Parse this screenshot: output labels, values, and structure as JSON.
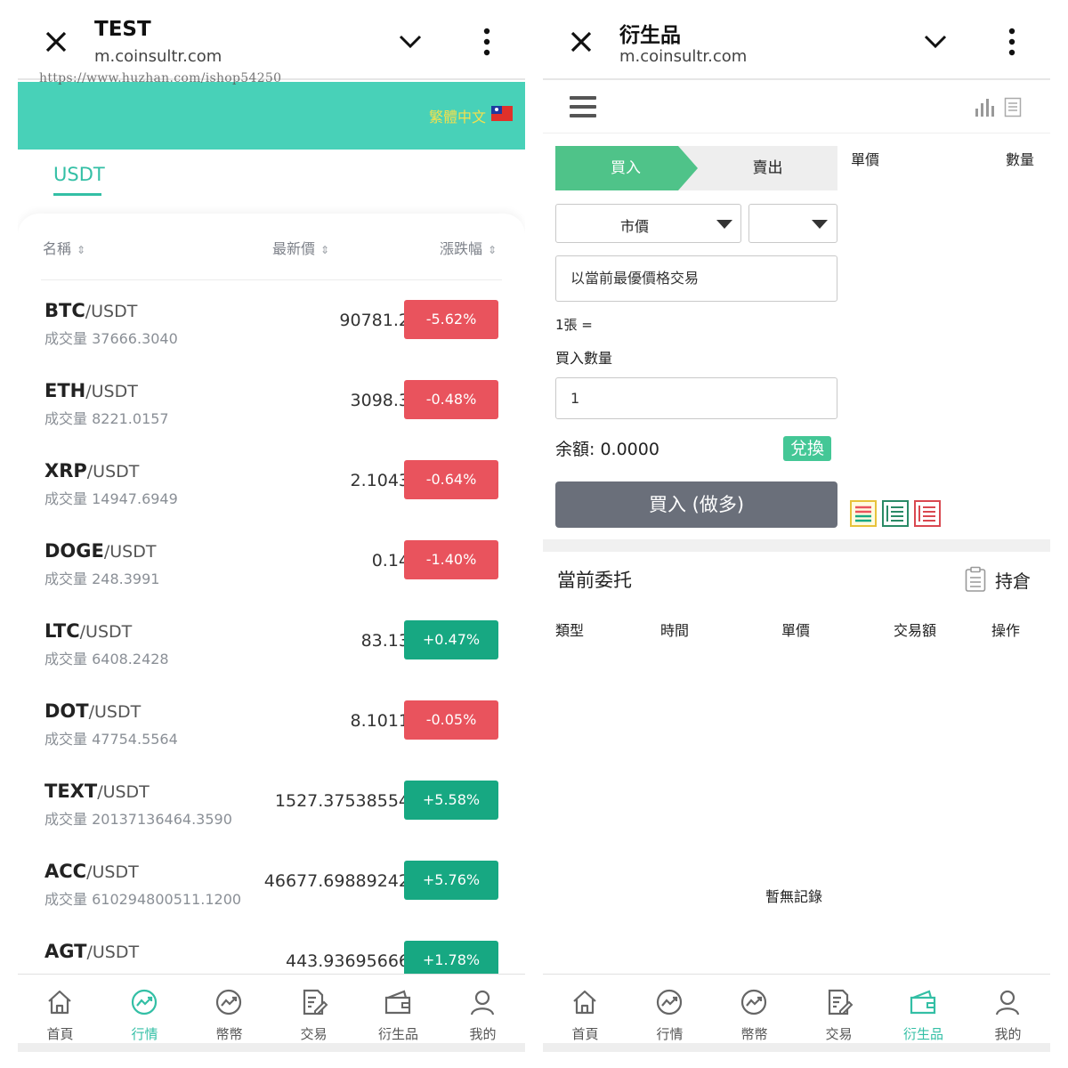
{
  "left": {
    "browser": {
      "title": "TEST",
      "url": "m.coinsultr.com"
    },
    "watermark": "https://www.huzhan.com/ishop54250",
    "language": "繁體中文",
    "tab": "USDT",
    "columns": {
      "name": "名稱",
      "price": "最新價",
      "change": "漲跌幅"
    },
    "markets": [
      {
        "base": "BTC",
        "quote": "/USDT",
        "volume": "成交量 37666.3040",
        "price": "90781.2",
        "change": "-5.62%",
        "dir": "down"
      },
      {
        "base": "ETH",
        "quote": "/USDT",
        "volume": "成交量 8221.0157",
        "price": "3098.3",
        "change": "-0.48%",
        "dir": "down"
      },
      {
        "base": "XRP",
        "quote": "/USDT",
        "volume": "成交量 14947.6949",
        "price": "2.1043",
        "change": "-0.64%",
        "dir": "down"
      },
      {
        "base": "DOGE",
        "quote": "/USDT",
        "volume": "成交量 248.3991",
        "price": "0.14",
        "change": "-1.40%",
        "dir": "down"
      },
      {
        "base": "LTC",
        "quote": "/USDT",
        "volume": "成交量 6408.2428",
        "price": "83.13",
        "change": "+0.47%",
        "dir": "up"
      },
      {
        "base": "DOT",
        "quote": "/USDT",
        "volume": "成交量 47754.5564",
        "price": "8.1011",
        "change": "-0.05%",
        "dir": "down"
      },
      {
        "base": "TEXT",
        "quote": "/USDT",
        "volume": "成交量 20137136464.3590",
        "price": "1527.37538554",
        "change": "+5.58%",
        "dir": "up"
      },
      {
        "base": "ACC",
        "quote": "/USDT",
        "volume": "成交量 610294800511.1200",
        "price": "46677.69889242",
        "change": "+5.76%",
        "dir": "up"
      },
      {
        "base": "AGT",
        "quote": "/USDT",
        "volume": "",
        "price": "443.93695666",
        "change": "+1.78%",
        "dir": "up"
      }
    ],
    "nav": [
      {
        "label": "首頁",
        "icon": "home-icon"
      },
      {
        "label": "行情",
        "icon": "market-icon",
        "active": true
      },
      {
        "label": "幣幣",
        "icon": "coin-trade-icon"
      },
      {
        "label": "交易",
        "icon": "trade-icon"
      },
      {
        "label": "衍生品",
        "icon": "wallet-icon"
      },
      {
        "label": "我的",
        "icon": "profile-icon"
      }
    ]
  },
  "right": {
    "browser": {
      "title": "衍生品",
      "url": "m.coinsultr.com"
    },
    "buy_tab": "買入",
    "sell_tab": "賣出",
    "head_price": "單價",
    "head_qty": "數量",
    "order_type": "市價",
    "second_select": "",
    "price_field": "以當前最優價格交易",
    "lot_text": "1張 =",
    "qty_label": "買入數量",
    "qty_value": "1",
    "balance": "余額:  0.0000",
    "swap": "兌換",
    "buy_button": "買入 (做多)",
    "orders_title": "當前委托",
    "hold": "持倉",
    "order_columns": [
      "類型",
      "時間",
      "單價",
      "交易額",
      "操作"
    ],
    "empty": "暫無記錄",
    "nav": [
      {
        "label": "首頁",
        "icon": "home-icon"
      },
      {
        "label": "行情",
        "icon": "market-icon"
      },
      {
        "label": "幣幣",
        "icon": "coin-trade-icon"
      },
      {
        "label": "交易",
        "icon": "trade-icon"
      },
      {
        "label": "衍生品",
        "icon": "wallet-icon",
        "active": true
      },
      {
        "label": "我的",
        "icon": "profile-icon"
      }
    ]
  },
  "colors": {
    "accent": "#33bfa5",
    "banner": "#48d1b8",
    "up": "#17a882",
    "down": "#e9535d",
    "buy": "#4fc389"
  }
}
